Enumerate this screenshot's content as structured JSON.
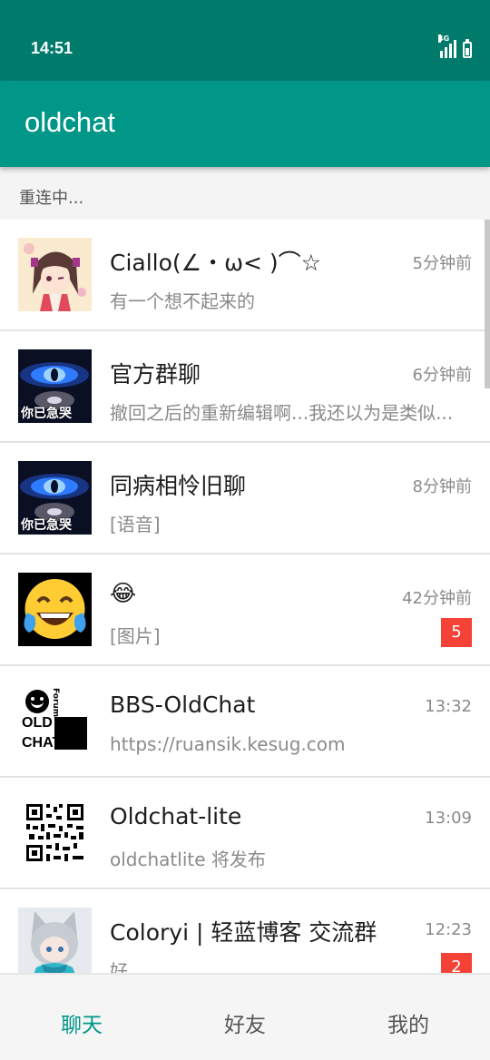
{
  "status_bar": {
    "time": "14:51",
    "network": "4G",
    "icons": [
      "signal-icon",
      "battery-charging-icon"
    ]
  },
  "app_bar": {
    "title": "oldchat",
    "color": "#009688"
  },
  "connection_status": "重连中...",
  "chats": [
    {
      "name": "Ciallo(∠・ω< )⌒☆",
      "preview": "有一个想不起来的",
      "time": "5分钟前",
      "avatar": "anime-girl-avatar",
      "unread": ""
    },
    {
      "name": "官方群聊",
      "preview": "撤回之后的重新编辑啊...我还以为是类似...",
      "time": "6分钟前",
      "avatar": "blue-eye-galaxy-avatar",
      "avatar_caption": "你已急哭",
      "unread": ""
    },
    {
      "name": "同病相怜旧聊",
      "preview": "[语音]",
      "time": "8分钟前",
      "avatar": "blue-eye-galaxy-avatar",
      "avatar_caption": "你已急哭",
      "unread": ""
    },
    {
      "name": "😂",
      "preview": "[图片]",
      "time": "42分钟前",
      "avatar": "tears-of-joy-emoji-avatar",
      "unread": "5"
    },
    {
      "name": "BBS-OldChat",
      "preview": "https://ruansik.kesug.com",
      "time": "13:32",
      "avatar": "oldchat-forum-logo-avatar",
      "avatar_logo": {
        "forum": "Forum",
        "line1": "OLD",
        "line2": "CHAT"
      },
      "unread": ""
    },
    {
      "name": "Oldchat-lite",
      "preview": "oldchatlite 将发布",
      "time": "13:09",
      "avatar": "qr-code-avatar",
      "unread": ""
    },
    {
      "name": "Coloryi | 轻蓝博客 交流群",
      "preview": "好",
      "time": "12:23",
      "avatar": "anime-cat-boy-avatar",
      "unread": "2"
    }
  ],
  "bottom_nav": {
    "tabs": [
      {
        "label": "聊天",
        "active": true
      },
      {
        "label": "好友",
        "active": false
      },
      {
        "label": "我的",
        "active": false
      }
    ]
  },
  "colors": {
    "primary": "#009688",
    "primary_dark": "#007a6b",
    "badge": "#f44336"
  }
}
